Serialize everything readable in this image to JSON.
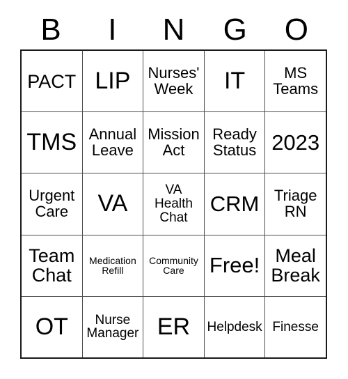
{
  "card": {
    "title": "BINGO",
    "headers": [
      "B",
      "I",
      "N",
      "G",
      "O"
    ],
    "free_space_label": "Free!",
    "rows": [
      [
        {
          "label": "PACT",
          "size": "lg"
        },
        {
          "label": "LIP",
          "size": "xxl"
        },
        {
          "label": "Nurses'\nWeek",
          "size": "md"
        },
        {
          "label": "IT",
          "size": "xxl"
        },
        {
          "label": "MS\nTeams",
          "size": "md"
        }
      ],
      [
        {
          "label": "TMS",
          "size": "xxl"
        },
        {
          "label": "Annual\nLeave",
          "size": "md"
        },
        {
          "label": "Mission\nAct",
          "size": "md"
        },
        {
          "label": "Ready\nStatus",
          "size": "md"
        },
        {
          "label": "2023",
          "size": "xl"
        }
      ],
      [
        {
          "label": "Urgent\nCare",
          "size": "md"
        },
        {
          "label": "VA",
          "size": "xxl"
        },
        {
          "label": "VA\nHealth\nChat",
          "size": "sm"
        },
        {
          "label": "CRM",
          "size": "xl"
        },
        {
          "label": "Triage\nRN",
          "size": "md"
        }
      ],
      [
        {
          "label": "Team\nChat",
          "size": "lg"
        },
        {
          "label": "Medication\nRefill",
          "size": "xs"
        },
        {
          "label": "Community\nCare",
          "size": "xs"
        },
        {
          "label": "Free!",
          "size": "xl"
        },
        {
          "label": "Meal\nBreak",
          "size": "lg"
        }
      ],
      [
        {
          "label": "OT",
          "size": "xxl"
        },
        {
          "label": "Nurse\nManager",
          "size": "sm"
        },
        {
          "label": "ER",
          "size": "xxl"
        },
        {
          "label": "Helpdesk",
          "size": "sm"
        },
        {
          "label": "Finesse",
          "size": "sm"
        }
      ]
    ]
  },
  "colors": {
    "background": "#ffffff",
    "text": "#000000",
    "grid_line": "#4d4d4d",
    "grid_border": "#1a1a1a"
  }
}
